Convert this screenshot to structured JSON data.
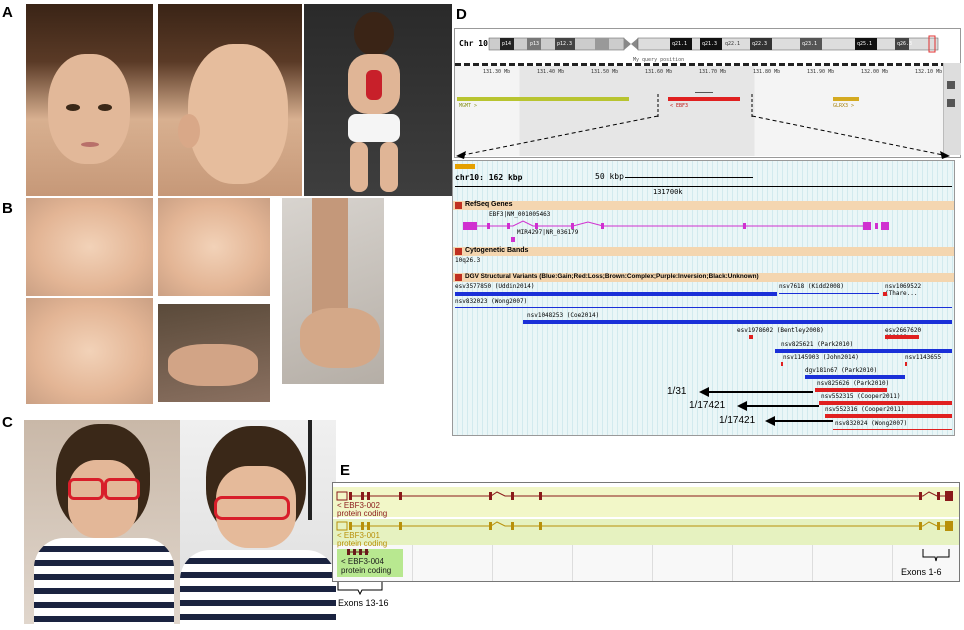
{
  "panels": {
    "a": "A",
    "b": "B",
    "c": "C",
    "d": "D",
    "e": "E"
  },
  "d": {
    "chrom": "Chr 10",
    "bands": [
      "p14",
      "p13",
      "p12.3",
      "q21.1",
      "q21.3",
      "q22.1",
      "q22.3",
      "q23.1",
      "q25.1",
      "q26.3"
    ],
    "query_label": "My query position",
    "ruler_ticks": [
      "131.30 Mb",
      "131.40 Mb",
      "131.50 Mb",
      "131.60 Mb",
      "131.70 Mb",
      "131.80 Mb",
      "131.90 Mb",
      "132.00 Mb",
      "132.10 Mb"
    ],
    "genes_top": [
      "MGMT >",
      "< EBF3",
      "GLRX3 >"
    ],
    "region": "chr10: 162 kbp",
    "scale": "50 kbp",
    "coord": "131700k",
    "refseq": "RefSeq Genes",
    "ebf3": "EBF3|NM_001005463",
    "mir": "MIR4297|NR_036179",
    "cyto": "Cytogenetic Bands",
    "band": "10q26.3",
    "dgv": "DGV Structural Variants (Blue:Gain;Red:Loss;Brown:Complex;Purple:Inversion;Black:Unknown)",
    "variants": {
      "v1": "esv3577850 (Uddin2014)",
      "v2": "nsv7618 (Kidd2008)",
      "v3": "nsv1069522 (Thare...",
      "v4": "nsv832023 (Wong2007)",
      "v5": "nsv1048253 (Coe2014)",
      "v6": "esv1978602 (Bentley2008)",
      "v7": "esv2667620 (1000G...",
      "v8": "nsv825621 (Park2010)",
      "v9": "nsv1145903 (John2014)",
      "v10": "nsv1143655",
      "v11": "dgv181n67 (Park2010)",
      "v12": "nsv825626 (Park2010)",
      "v13": "nsv552315 (Cooper2011)",
      "v14": "nsv552316 (Cooper2011)",
      "v15": "nsv832024 (Wong2007)"
    },
    "freqs": [
      "1/31",
      "1/17421",
      "1/17421"
    ]
  },
  "e": {
    "t1": "< EBF3-002",
    "t2": "< EBF3-001",
    "t3": "< EBF3-004",
    "coding": "protein coding",
    "ex_left": "Exons 13-16",
    "ex_right": "Exons 1-6"
  }
}
